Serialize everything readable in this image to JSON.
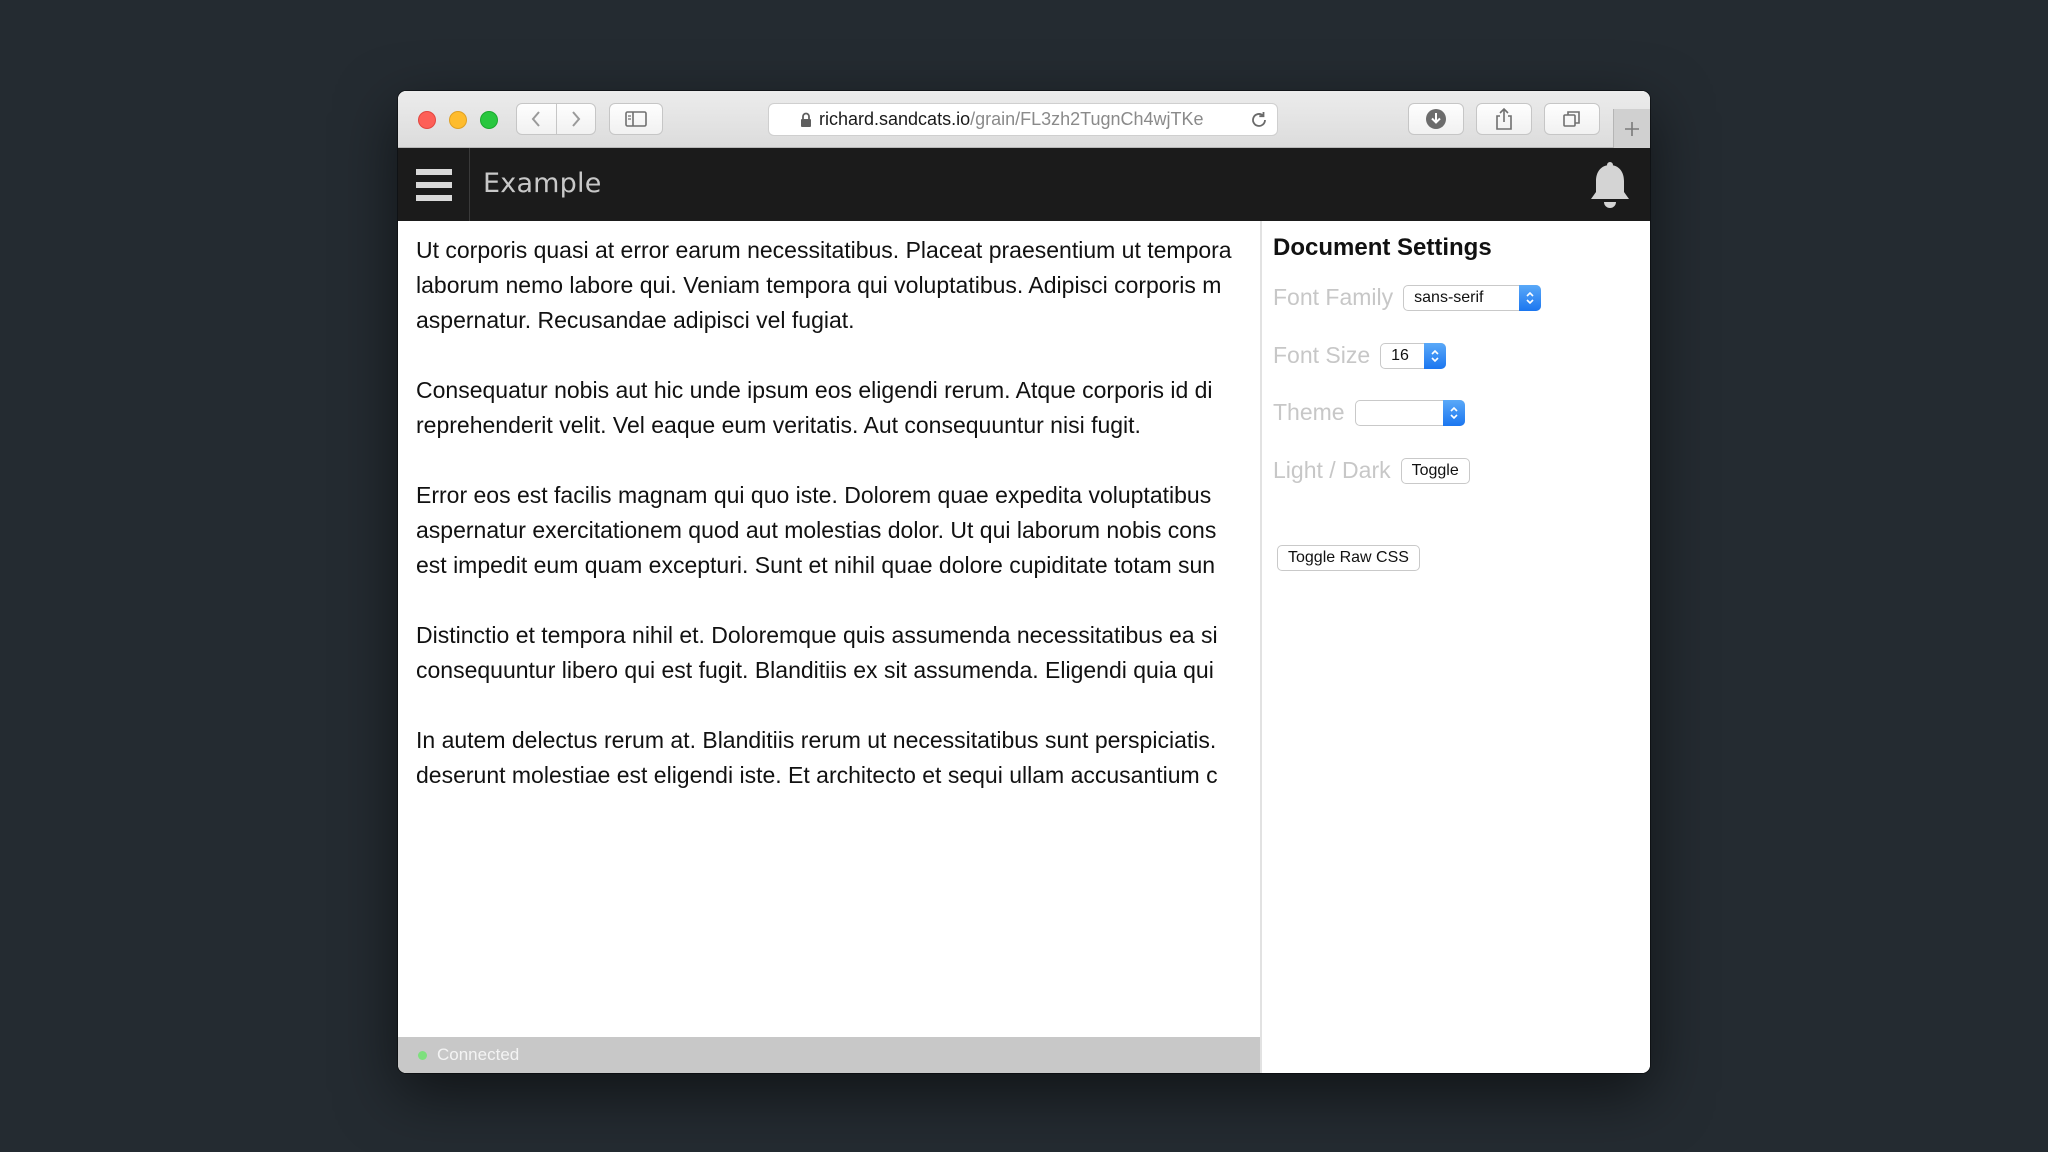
{
  "browser": {
    "url_host": "richard.sandcats.io",
    "url_path": "/grain/FL3zh2TugnCh4wjTKe",
    "icons": [
      "close-light",
      "minimize-light",
      "zoom-light",
      "back-icon",
      "forward-icon",
      "sidebar-icon",
      "lock-icon",
      "reload-icon",
      "download-icon",
      "share-icon",
      "tabs-icon",
      "new-tab-icon"
    ]
  },
  "appbar": {
    "title": "Example",
    "icons": [
      "hamburger-menu-icon",
      "bell-icon"
    ]
  },
  "content": {
    "paragraphs": [
      {
        "line1": "Ut corporis quasi at error earum necessitatibus. Placeat praesentium ut tempora",
        "line2": "laborum nemo labore qui. Veniam tempora qui voluptatibus. Adipisci corporis m",
        "line3": "aspernatur. Recusandae adipisci vel fugiat."
      },
      {
        "line1": "Consequatur nobis aut hic unde ipsum eos eligendi rerum. Atque corporis id di",
        "line2": "reprehenderit velit. Vel eaque eum veritatis. Aut consequuntur nisi fugit."
      },
      {
        "line1": "Error eos est facilis magnam qui quo iste. Dolorem quae expedita voluptatibus",
        "line2": "aspernatur exercitationem quod aut molestias dolor. Ut qui laborum nobis cons",
        "line3": "est impedit eum quam excepturi. Sunt et nihil quae dolore cupiditate totam sun"
      },
      {
        "line1": "Distinctio et tempora nihil et. Doloremque quis assumenda necessitatibus ea si",
        "line2": "consequuntur libero qui est fugit. Blanditiis ex sit assumenda. Eligendi quia qui"
      },
      {
        "line1": "In autem delectus rerum at. Blanditiis rerum ut necessitatibus sunt perspiciatis.",
        "line2": "deserunt molestiae est eligendi iste. Et architecto et sequi ullam accusantium c"
      }
    ]
  },
  "status": {
    "text": "Connected",
    "dot_color": "#7ee07e"
  },
  "settings": {
    "title": "Document Settings",
    "font_family_label": "Font Family",
    "font_family_value": "sans-serif",
    "font_size_label": "Font Size",
    "font_size_value": "16",
    "theme_label": "Theme",
    "theme_value": "",
    "light_dark_label": "Light / Dark",
    "toggle_label": "Toggle",
    "toggle_raw_css_label": "Toggle Raw CSS"
  },
  "colors": {
    "desktop_bg": "#242b31",
    "appbar_bg": "#1b1b1b",
    "select_accent": "#1b76f0"
  }
}
